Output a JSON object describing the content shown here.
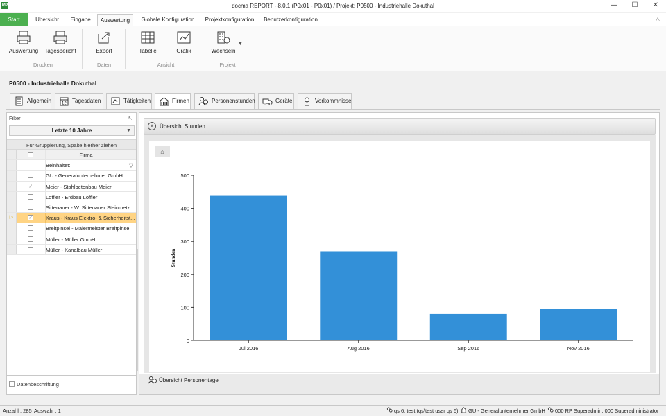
{
  "window": {
    "title": "docma REPORT - 8.0.1 (P0x01 - P0x01) / Projekt: P0500 - Industriehalle Dokuthal",
    "app_icon": "app-icon",
    "minimize_icon": "minimize-icon",
    "maximize_icon": "maximize-icon",
    "close_icon": "close-icon"
  },
  "ribbon_tabs": {
    "start": "Start",
    "uebersicht": "Übersicht",
    "eingabe": "Eingabe",
    "auswertung": "Auswertung",
    "globale": "Globale Konfiguration",
    "projekt": "Projektkonfiguration",
    "benutzer": "Benutzerkonfiguration",
    "active": "Auswertung"
  },
  "ribbon": {
    "auswertung_btn": "Auswertung",
    "tagesbericht_btn": "Tagesbericht",
    "group_drucken": "Drucken",
    "export_btn": "Export",
    "group_daten": "Daten",
    "tabelle_btn": "Tabelle",
    "grafik_btn": "Grafik",
    "group_ansicht": "Ansicht",
    "wechseln_btn": "Wechseln",
    "group_projekt": "Projekt"
  },
  "project": {
    "title": "P0500 - Industriehalle Dokuthal"
  },
  "content_tabs": {
    "allgemein": "Allgemein",
    "tagesdaten": "Tagesdaten",
    "taetigkeiten": "Tätigkeiten",
    "firmen": "Firmen",
    "personenstunden": "Personenstunden",
    "geraete": "Geräte",
    "vorkommnisse": "Vorkommnisse",
    "active": "Firmen"
  },
  "left_panel": {
    "filter_label": "Filter",
    "dropdown_value": "Letzte 10 Jahre",
    "group_hint": "Für Gruppierung, Spalte hierher ziehen",
    "column_header": "Firma",
    "filter_row_label": "Beinhaltet:",
    "rows": [
      {
        "name": "GU - Generalunternehmer GmbH",
        "checked": false,
        "selected": false
      },
      {
        "name": "Meier - Stahlbetonbau Meier",
        "checked": true,
        "selected": false
      },
      {
        "name": "Löffler - Erdbau Löffler",
        "checked": false,
        "selected": false
      },
      {
        "name": "Sittenauer - W. Sittenauer Steinmetz...",
        "checked": false,
        "selected": false
      },
      {
        "name": "Kraus - Kraus Elektro- & Sicherheitst...",
        "checked": true,
        "selected": true
      },
      {
        "name": "Breitpinsel - Malermeister Breitpinsel",
        "checked": false,
        "selected": false
      },
      {
        "name": "Müller - Müller GmbH",
        "checked": false,
        "selected": false
      },
      {
        "name": "Müller - Kanalbau Müller",
        "checked": false,
        "selected": false
      }
    ],
    "datenbeschriftung": "Datenbeschriftung"
  },
  "right_panel": {
    "section_title": "Übersicht Stunden",
    "footer_link": "Übersicht Personentage"
  },
  "chart_data": {
    "type": "bar",
    "categories": [
      "Jul 2016",
      "Aug 2016",
      "Sep 2016",
      "Nov 2016"
    ],
    "values": [
      440,
      270,
      80,
      95
    ],
    "ylabel": "Stunden",
    "ylim": [
      0,
      500
    ],
    "yticks": [
      0,
      100,
      200,
      300,
      400,
      500
    ],
    "ytick_labels": [
      "0",
      "100",
      "200",
      "300",
      "400",
      "500"
    ],
    "bar_color": "#3390d8",
    "grid": false
  },
  "statusbar": {
    "anzahl": "Anzahl : 285",
    "auswahl": "Auswahl : 1",
    "user": "qs 6, test (qs\\test user qs 6)",
    "company": "GU - Generalunternehmer GmbH",
    "role": "000 RP Superadmin, 000 Superadministrator"
  },
  "colors": {
    "start_tab": "#4cb050",
    "selection": "#ffd484",
    "bar": "#3390d8"
  }
}
